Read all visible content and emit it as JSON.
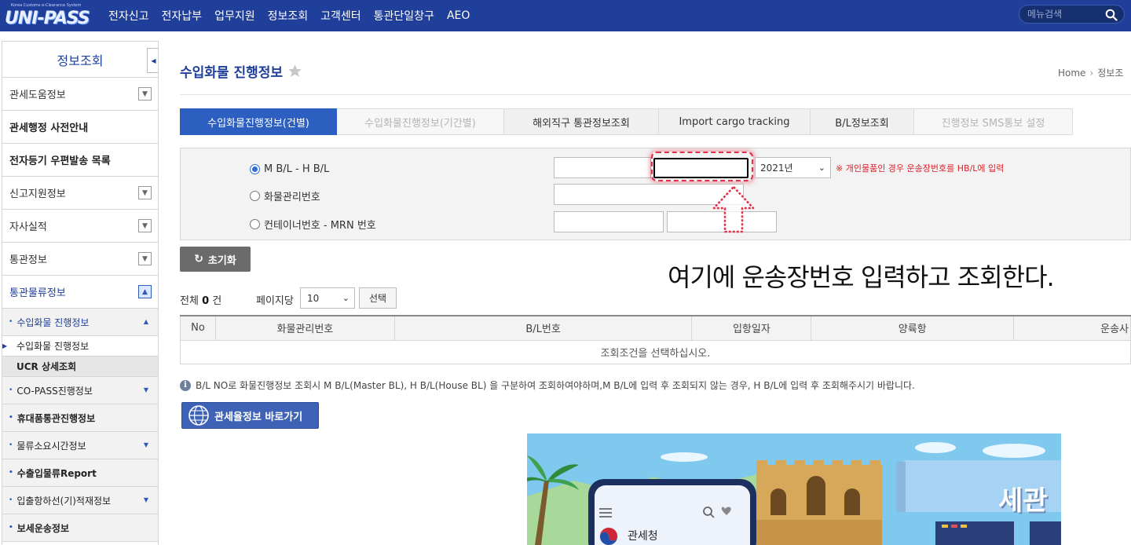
{
  "header": {
    "logo_text": "UNI-PASS",
    "logo_subtext": "Korea Customs e-Clearance System",
    "nav": [
      "전자신고",
      "전자납부",
      "업무지원",
      "정보조회",
      "고객센터",
      "통관단일창구",
      "AEO"
    ],
    "search_placeholder": "메뉴검색"
  },
  "sidebar": {
    "title": "정보조회",
    "items": [
      {
        "label": "관세도움정보"
      },
      {
        "label": "관세행정 사전안내"
      },
      {
        "label": "전자등기 우편발송 목록"
      },
      {
        "label": "신고지원정보"
      },
      {
        "label": "자사실적"
      },
      {
        "label": "통관정보"
      },
      {
        "label": "통관물류정보"
      }
    ],
    "subitems": [
      {
        "label": "수입화물 진행정보"
      },
      {
        "label": "수입화물 진행정보"
      },
      {
        "label": "UCR 상세조회"
      },
      {
        "label": "CO-PASS진행정보"
      },
      {
        "label": "휴대품통관진행정보"
      },
      {
        "label": "물류소요시간정보"
      },
      {
        "label": "수출입물류Report"
      },
      {
        "label": "입출항하선(기)적재정보"
      },
      {
        "label": "보세운송정보"
      }
    ]
  },
  "page": {
    "title": "수입화물 진행정보",
    "breadcrumb_home": "Home",
    "breadcrumb_current": "정보조"
  },
  "tabs": [
    {
      "label": "수입화물진행정보(건별)"
    },
    {
      "label": "수입화물진행정보(기간별)"
    },
    {
      "label": "해외직구 통관정보조회"
    },
    {
      "label": "Import cargo tracking"
    },
    {
      "label": "B/L정보조회"
    },
    {
      "label": "진행정보 SMS통보 설정"
    }
  ],
  "search": {
    "options": [
      {
        "label": "M B/L - H B/L",
        "checked": true
      },
      {
        "label": "화물관리번호",
        "checked": false
      },
      {
        "label": "컨테이너번호 - MRN 번호",
        "checked": false
      }
    ],
    "year": "2021년",
    "notice": "※ 개인물품인 경우 운송장번호를 HB/L에 입력",
    "reset_label": "초기화"
  },
  "annotation": "여기에 운송장번호 입력하고 조회한다.",
  "results": {
    "total_prefix": "전체",
    "total_count": "0",
    "total_suffix": "건",
    "perpage_label": "페이지당",
    "perpage_value": "10",
    "choose_label": "선택",
    "columns": [
      "No",
      "화물관리번호",
      "B/L번호",
      "입항일자",
      "양륙항",
      "운송사"
    ],
    "empty_message": "조회조건을 선택하십시오."
  },
  "info_note": "B/L NO로 화물진행정보 조회시 M B/L(Master BL), H B/L(House BL) 을 구분하여 조회하여야하며,M B/L에 입력 후 조회되지 않는 경우, H B/L에 입력 후 조회해주시기 바랍니다.",
  "tariff_button": "관세율정보 바로가기",
  "banner": {
    "title": "세관",
    "phone_label": "관세청"
  },
  "colors": {
    "brand": "#1f3f9a",
    "active_tab": "#2d5fc0",
    "notice_red": "#e0202a"
  }
}
